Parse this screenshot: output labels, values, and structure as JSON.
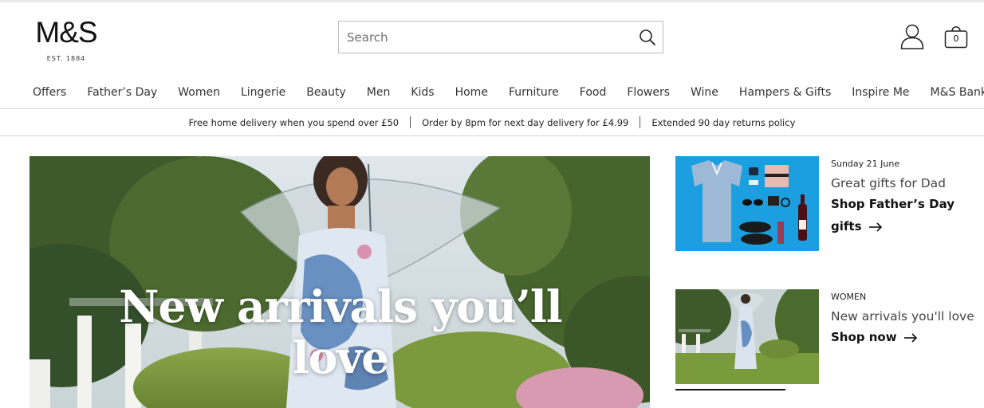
{
  "header": {
    "logo": "M&S",
    "logo_sub": "EST. 1884",
    "search_placeholder": "Search",
    "bag_count": "0"
  },
  "nav": {
    "items": [
      "Offers",
      "Father’s Day",
      "Women",
      "Lingerie",
      "Beauty",
      "Men",
      "Kids",
      "Home",
      "Furniture",
      "Food",
      "Flowers",
      "Wine",
      "Hampers & Gifts",
      "Inspire Me",
      "M&S Bank"
    ]
  },
  "delivery": {
    "messages": [
      "Free home delivery when you spend over £50",
      "Order by 8pm for next day delivery for £4.99",
      "Extended 90 day returns policy"
    ]
  },
  "hero": {
    "headline": "New arrivals you’ll love"
  },
  "promos": [
    {
      "eyebrow": "Sunday 21 June",
      "title": "Great gifts for Dad",
      "link": "Shop Father’s Day gifts"
    },
    {
      "eyebrow": "WOMEN",
      "title": "New arrivals you'll love",
      "link": "Shop now"
    }
  ],
  "icons": {
    "search": "search-icon",
    "account": "account-icon",
    "bag": "shopping-bag-icon",
    "arrow": "arrow-right-icon"
  },
  "colors": {
    "text": "#222222",
    "border": "#bdbdbd",
    "promo1_bg": "#1c9fe0"
  }
}
